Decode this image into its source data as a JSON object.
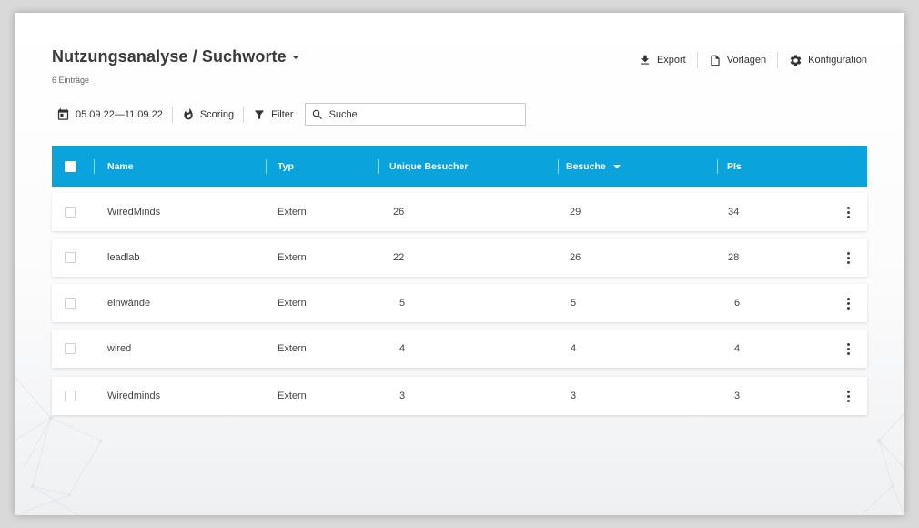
{
  "header": {
    "title": "Nutzungsanalyse / Suchworte",
    "count": "6 Einträge"
  },
  "actions": {
    "export_label": "Export",
    "templates_label": "Vorlagen",
    "config_label": "Konfiguration"
  },
  "toolbar": {
    "date_range": "05.09.22—11.09.22",
    "scoring_label": "Scoring",
    "filter_label": "Filter",
    "search_placeholder": "Suche"
  },
  "table": {
    "columns": {
      "name": "Name",
      "type": "Typ",
      "unique": "Unique Besucher",
      "visits": "Besuche",
      "pis": "PIs"
    },
    "sort_column": "visits",
    "rows": [
      {
        "name": "WiredMinds",
        "type": "Extern",
        "unique": "26",
        "visits": "29",
        "pis": "34"
      },
      {
        "name": "leadlab",
        "type": "Extern",
        "unique": "22",
        "visits": "26",
        "pis": "28"
      },
      {
        "name": "einwände",
        "type": "Extern",
        "unique": "5",
        "visits": "5",
        "pis": "6"
      },
      {
        "name": "wired",
        "type": "Extern",
        "unique": "4",
        "visits": "4",
        "pis": "4"
      },
      {
        "name": "Wiredminds",
        "type": "Extern",
        "unique": "3",
        "visits": "3",
        "pis": "3"
      }
    ]
  },
  "colors": {
    "accent": "#0aa3dc",
    "background": "#ffffff"
  },
  "icons": [
    "download-icon",
    "document-icon",
    "gear-icon",
    "calendar-icon",
    "flame-icon",
    "filter-icon",
    "search-icon",
    "more-vert-icon"
  ]
}
